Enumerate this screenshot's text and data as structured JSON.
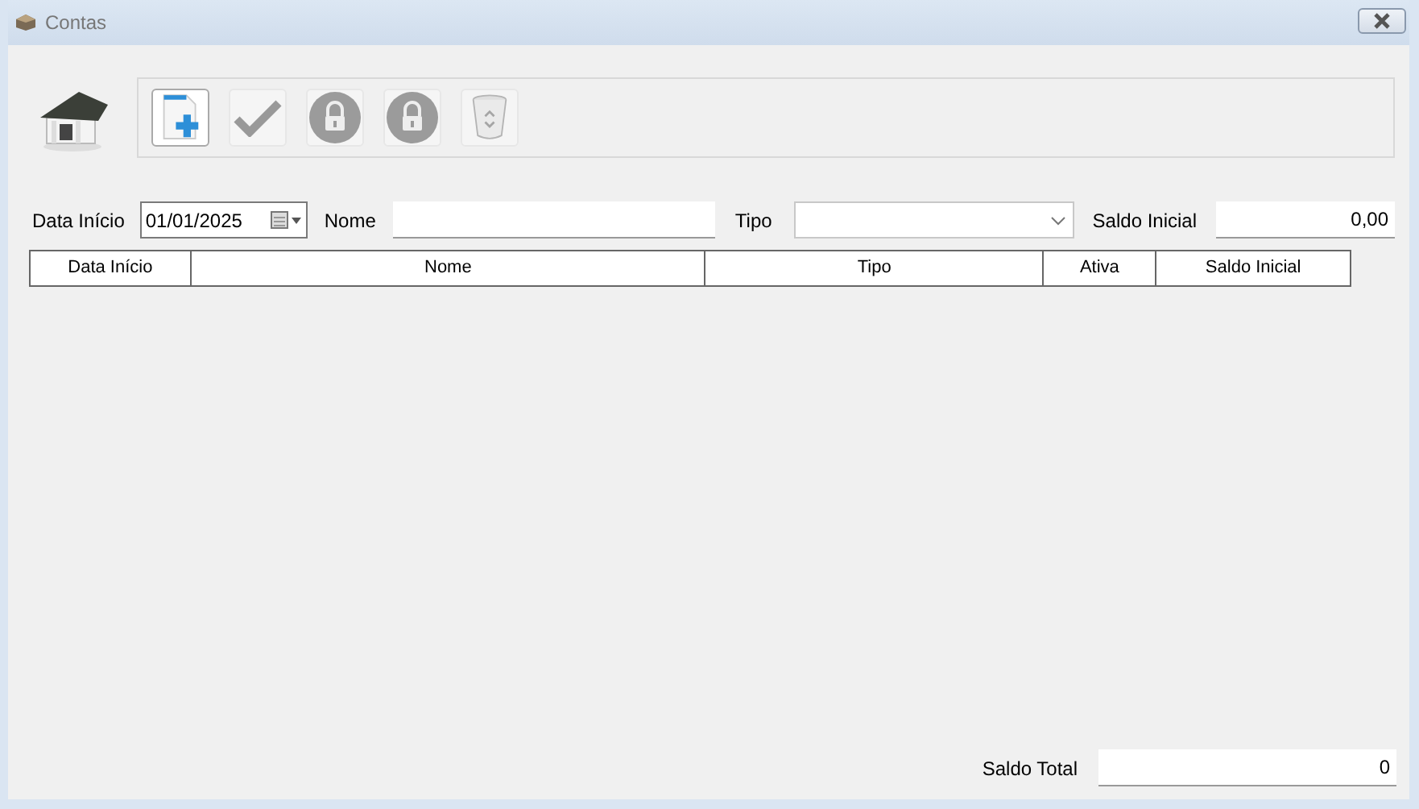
{
  "window": {
    "title": "Contas"
  },
  "toolbar": [
    {
      "kind": "new",
      "disabled": false
    },
    {
      "kind": "check",
      "disabled": true
    },
    {
      "kind": "lock",
      "disabled": true
    },
    {
      "kind": "lock",
      "disabled": true
    },
    {
      "kind": "trash",
      "disabled": true
    }
  ],
  "filters": {
    "data_inicio": {
      "label": "Data Início",
      "value": "01/01/2025"
    },
    "nome": {
      "label": "Nome"
    },
    "tipo": {
      "label": "Tipo"
    },
    "saldo_inicial": {
      "label": "Saldo Inicial",
      "value": "0,00"
    }
  },
  "table": {
    "columns": [
      "Data Início",
      "Nome",
      "Tipo",
      "Ativa",
      "Saldo Inicial"
    ]
  },
  "footer": {
    "label": "Saldo Total",
    "value": "0"
  }
}
